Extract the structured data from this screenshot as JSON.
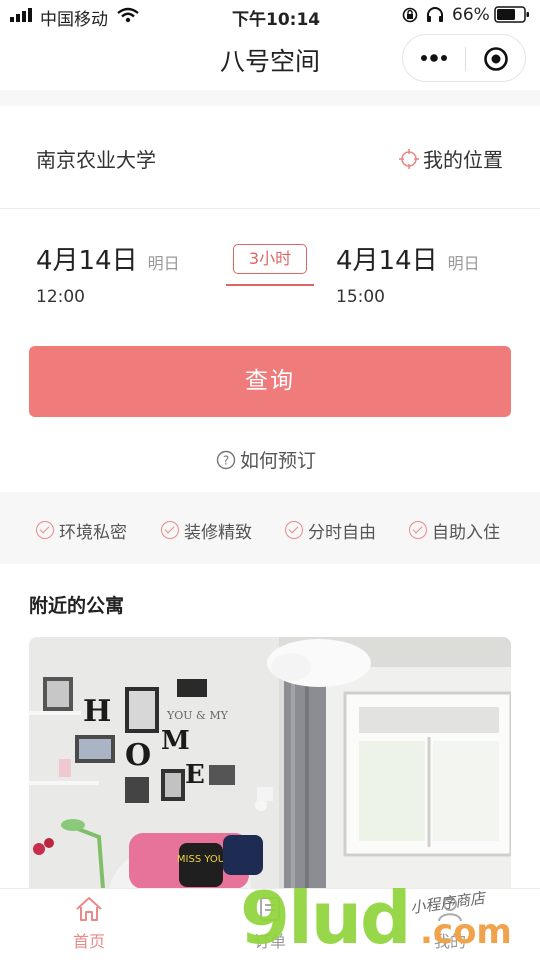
{
  "status_bar": {
    "carrier": "中国移动",
    "time": "下午10:14",
    "battery": "66%"
  },
  "nav": {
    "title": "八号空间"
  },
  "location": {
    "current": "南京农业大学",
    "my_location_label": "我的位置"
  },
  "booking": {
    "start_date": "4月14日",
    "start_day": "明日",
    "start_time": "12:00",
    "duration": "3小时",
    "end_date": "4月14日",
    "end_day": "明日",
    "end_time": "15:00"
  },
  "search_button": "查询",
  "how_to_book": "如何预订",
  "features": [
    "环境私密",
    "装修精致",
    "分时自由",
    "自助入住"
  ],
  "nearby": {
    "title": "附近的公寓",
    "photo_letters": [
      "H",
      "O",
      "M",
      "E"
    ],
    "photo_small_text": "YOU & MY",
    "pillow_text": "MISS YOU"
  },
  "tabbar": {
    "tabs": [
      {
        "label": "首页",
        "icon": "home-icon",
        "active": true
      },
      {
        "label": "订单",
        "icon": "order-icon",
        "active": false
      },
      {
        "label": "我的",
        "icon": "profile-icon",
        "active": false
      }
    ]
  },
  "watermark": {
    "main": "9lud",
    "suffix": ".com",
    "handwritten": "小程序商店"
  },
  "colors": {
    "accent": "#ef7b7b",
    "accent_dark": "#e06565",
    "watermark_green": "#8fd43a",
    "watermark_orange": "#f0a34a"
  }
}
